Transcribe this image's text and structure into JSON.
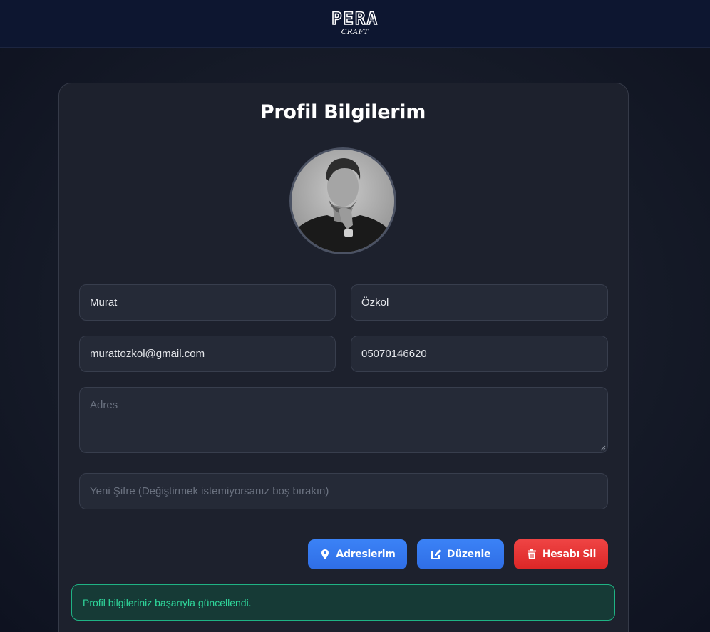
{
  "brand": {
    "logo_main": "PERA",
    "logo_sub": "CRAFT"
  },
  "profile": {
    "title": "Profil Bilgilerim",
    "first_name": "Murat",
    "last_name": "Özkol",
    "email": "murattozkol@gmail.com",
    "phone": "05070146620",
    "address_placeholder": "Adres",
    "password_placeholder": "Yeni Şifre (Değiştirmek istemiyorsanız boş bırakın)"
  },
  "actions": {
    "addresses_label": "Adreslerim",
    "edit_label": "Düzenle",
    "delete_label": "Hesabı Sil"
  },
  "icons": {
    "addresses": "map-pin-icon",
    "edit": "edit-icon",
    "delete": "trash-icon"
  },
  "alert": {
    "message": "Profil bilgileriniz başarıyla güncellendi."
  },
  "colors": {
    "primary": "#3b82f6",
    "danger": "#ef4444",
    "success": "#2fd69b",
    "header_bg": "#0d1630",
    "card_bg": "#1d212d"
  }
}
